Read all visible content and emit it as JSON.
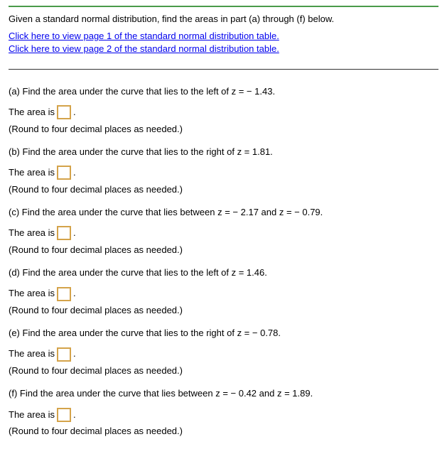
{
  "intro": "Given a standard normal distribution, find the areas in part (a) through (f) below.",
  "links": {
    "page1": "Click here to view page 1 of the standard normal distribution table.",
    "page2": "Click here to view page 2 of the standard normal distribution table."
  },
  "answer_prefix": "The area is",
  "answer_suffix": ".",
  "hint": "(Round to four decimal places as needed.)",
  "parts": {
    "a": "(a) Find the area under the curve that lies to the left of z = − 1.43.",
    "b": "(b) Find the area under the curve that lies to the right of z = 1.81.",
    "c": "(c) Find the area under the curve that lies between z = − 2.17 and z = − 0.79.",
    "d": "(d) Find the area under the curve that lies to the left of z = 1.46.",
    "e": "(e) Find the area under the curve that lies to the right of z = − 0.78.",
    "f": "(f) Find the area under the curve that lies between z = − 0.42 and z = 1.89."
  }
}
